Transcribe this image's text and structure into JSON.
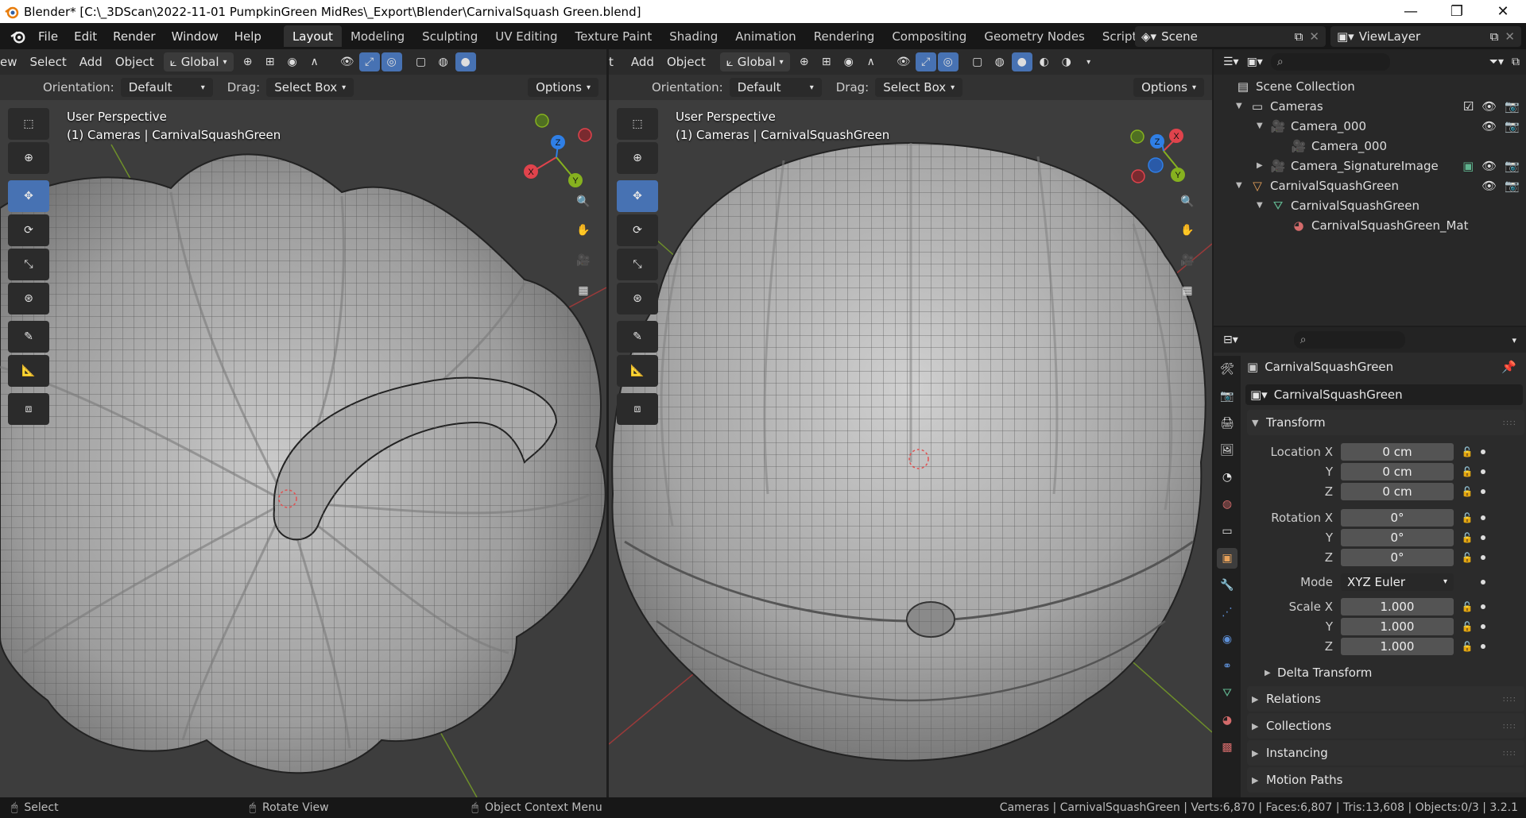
{
  "window": {
    "title": "Blender* [C:\\_3DScan\\2022-11-01 PumpkinGreen MidRes\\_Export\\Blender\\CarnivalSquash Green.blend]",
    "minimize": "—",
    "maximize": "❐",
    "close": "✕"
  },
  "menu": [
    "File",
    "Edit",
    "Render",
    "Window",
    "Help"
  ],
  "workspaces": [
    {
      "label": "Layout",
      "active": true
    },
    {
      "label": "Modeling"
    },
    {
      "label": "Sculpting"
    },
    {
      "label": "UV Editing"
    },
    {
      "label": "Texture Paint"
    },
    {
      "label": "Shading"
    },
    {
      "label": "Animation"
    },
    {
      "label": "Rendering"
    },
    {
      "label": "Compositing"
    },
    {
      "label": "Geometry Nodes"
    },
    {
      "label": "Scripting"
    }
  ],
  "workspace_add": "+",
  "scene": {
    "name": "Scene",
    "view_layer": "ViewLayer"
  },
  "viewport_left": {
    "menu": [
      "ew",
      "Select",
      "Add",
      "Object"
    ],
    "transform": "Global",
    "orientation_label": "Orientation:",
    "orientation": "Default",
    "drag_label": "Drag:",
    "drag": "Select Box",
    "options": "Options",
    "perspective": "User Perspective",
    "collection": "(1) Cameras | CarnivalSquashGreen"
  },
  "viewport_right": {
    "menu": [
      "t",
      "Add",
      "Object"
    ],
    "transform": "Global",
    "orientation_label": "Orientation:",
    "orientation": "Default",
    "drag_label": "Drag:",
    "drag": "Select Box",
    "options": "Options",
    "perspective": "User Perspective",
    "collection": "(1) Cameras | CarnivalSquashGreen"
  },
  "outliner": {
    "rows": [
      {
        "label": "Scene Collection",
        "indent": 0
      },
      {
        "label": "Cameras",
        "indent": 1
      },
      {
        "label": "Camera_000",
        "indent": 2
      },
      {
        "label": "Camera_000",
        "indent": 3
      },
      {
        "label": "Camera_SignatureImage",
        "indent": 2
      },
      {
        "label": "CarnivalSquashGreen",
        "indent": 1
      },
      {
        "label": "CarnivalSquashGreen",
        "indent": 2
      },
      {
        "label": "CarnivalSquashGreen_Mat",
        "indent": 3
      }
    ]
  },
  "properties": {
    "object_name": "CarnivalSquashGreen",
    "object_field": "CarnivalSquashGreen",
    "transform_label": "Transform",
    "location": {
      "label_x": "Location X",
      "x": "0 cm",
      "y": "0 cm",
      "z": "0 cm"
    },
    "rotation": {
      "label_x": "Rotation X",
      "x": "0°",
      "y": "0°",
      "z": "0°"
    },
    "mode_label": "Mode",
    "mode": "XYZ Euler",
    "scale": {
      "label_x": "Scale X",
      "x": "1.000",
      "y": "1.000",
      "z": "1.000"
    },
    "axis_y": "Y",
    "axis_z": "Z",
    "subpanels": [
      "Delta Transform",
      "Relations",
      "Collections",
      "Instancing",
      "Motion Paths"
    ]
  },
  "status": {
    "select": "Select",
    "rotate": "Rotate View",
    "context": "Object Context Menu",
    "stats": "Cameras | CarnivalSquashGreen | Verts:6,870 | Faces:6,807 | Tris:13,608 | Objects:0/3 | 3.2.1"
  },
  "gizmo": {
    "x": "X",
    "y": "Y",
    "z": "Z"
  },
  "colors": {
    "accent": "#4772b3",
    "axis_x": "#e0434c",
    "axis_y": "#86b11f",
    "axis_z": "#2f7fe6"
  }
}
